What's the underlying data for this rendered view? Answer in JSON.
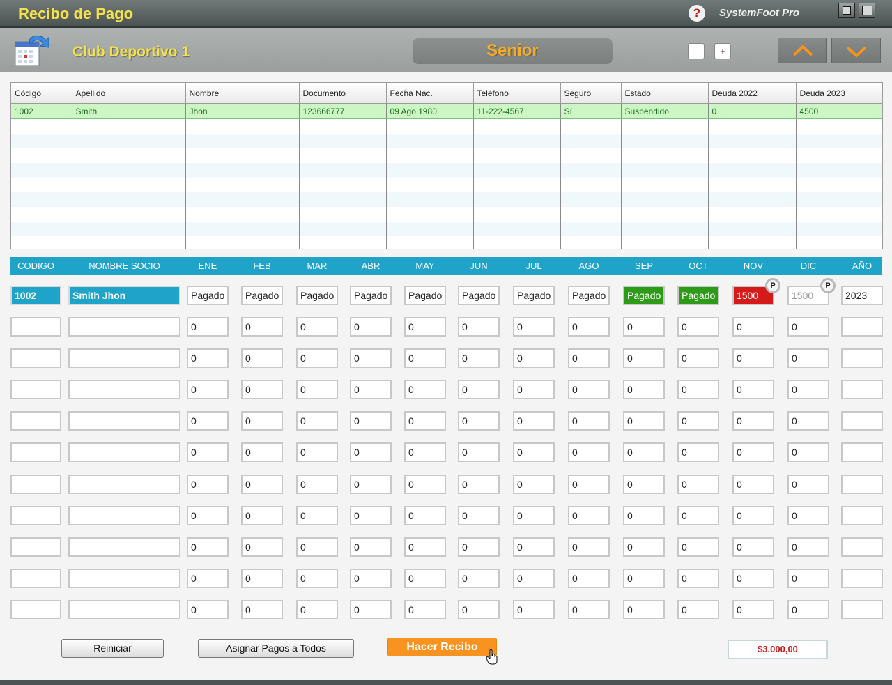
{
  "window": {
    "title": "Recibo de Pago",
    "brand": "SystemFoot Pro",
    "help_label": "?"
  },
  "header": {
    "club": "Club Deportivo 1",
    "category": "Senior",
    "minus_label": "-",
    "plus_label": "+"
  },
  "members_table": {
    "columns": [
      "Código",
      "Apellido",
      "Nombre",
      "Documento",
      "Fecha Nac.",
      "Teléfono",
      "Seguro",
      "Estado",
      "Deuda 2022",
      "Deuda 2023"
    ],
    "rows": [
      [
        "1002",
        "Smith",
        "Jhon",
        "123666777",
        "09 Ago 1980",
        "11-222-4567",
        "Sí",
        "Suspendido",
        "0",
        "4500"
      ]
    ],
    "empty_rows": 9
  },
  "payments": {
    "headers": [
      "CODIGO",
      "NOMBRE SOCIO",
      "ENE",
      "FEB",
      "MAR",
      "ABR",
      "MAY",
      "JUN",
      "JUL",
      "AGO",
      "SEP",
      "OCT",
      "NOV",
      "DIC",
      "AÑO"
    ],
    "first_row": {
      "codigo": "1002",
      "nombre": "Smith Jhon",
      "months": [
        "Pagado",
        "Pagado",
        "Pagado",
        "Pagado",
        "Pagado",
        "Pagado",
        "Pagado",
        "Pagado",
        "Pagado",
        "Pagado",
        "1500",
        "1500"
      ],
      "month_status": [
        "plain",
        "plain",
        "plain",
        "plain",
        "plain",
        "plain",
        "plain",
        "plain",
        "green",
        "green",
        "red",
        "grey"
      ],
      "anio": "2023",
      "badge_label": "P"
    },
    "empty_row_value": "0",
    "empty_rows": 10
  },
  "footer": {
    "reset_label": "Reiniciar",
    "assign_label": "Asignar Pagos a Todos",
    "receipt_label": "Hacer Recibo",
    "total": "$3.000,00"
  },
  "colors": {
    "title_yellow": "#f4e24a",
    "accent_blue": "#1fa3c9",
    "paid_green": "#2e9b18",
    "owed_red": "#d51a1a",
    "orange": "#f7931e"
  }
}
